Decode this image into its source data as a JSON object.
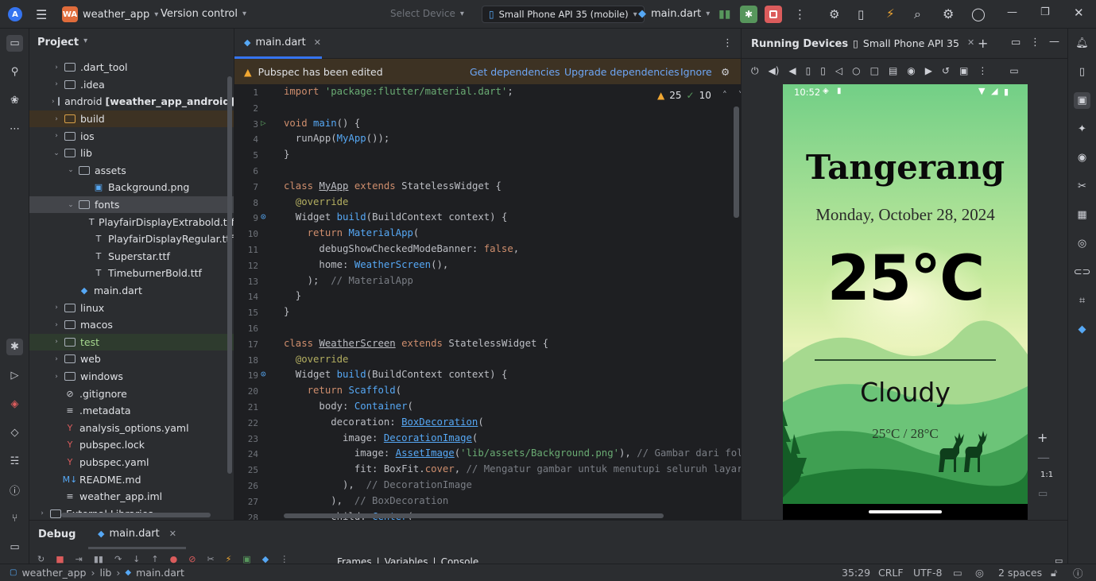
{
  "titlebar": {
    "project_badge": "WA",
    "project_name": "weather_app",
    "version_control": "Version control",
    "select_device": "Select Device",
    "device": "Small Phone API 35 (mobile)",
    "run_config": "main.dart"
  },
  "project_panel": {
    "title": "Project",
    "items": [
      {
        "label": ".dart_tool",
        "type": "folder",
        "indent": 1,
        "expanded": false
      },
      {
        "label": ".idea",
        "type": "folder",
        "indent": 1,
        "expanded": false
      },
      {
        "label": "android",
        "suffix": "[weather_app_android]",
        "type": "folder",
        "indent": 1,
        "expanded": false
      },
      {
        "label": "build",
        "type": "folder",
        "indent": 1,
        "expanded": false,
        "highlight": true
      },
      {
        "label": "ios",
        "type": "folder",
        "indent": 1,
        "expanded": false
      },
      {
        "label": "lib",
        "type": "folder",
        "indent": 1,
        "expanded": true
      },
      {
        "label": "assets",
        "type": "folder",
        "indent": 2,
        "expanded": true
      },
      {
        "label": "Background.png",
        "type": "image",
        "indent": 3
      },
      {
        "label": "fonts",
        "type": "folder",
        "indent": 2,
        "expanded": true,
        "selected": true
      },
      {
        "label": "PlayfairDisplayExtrabold.ttf",
        "type": "font",
        "indent": 3
      },
      {
        "label": "PlayfairDisplayRegular.ttf",
        "type": "font",
        "indent": 3
      },
      {
        "label": "Superstar.ttf",
        "type": "font",
        "indent": 3
      },
      {
        "label": "TimeburnerBold.ttf",
        "type": "font",
        "indent": 3
      },
      {
        "label": "main.dart",
        "type": "dart",
        "indent": 2
      },
      {
        "label": "linux",
        "type": "folder",
        "indent": 1,
        "expanded": false
      },
      {
        "label": "macos",
        "type": "folder",
        "indent": 1,
        "expanded": false
      },
      {
        "label": "test",
        "type": "folder",
        "indent": 1,
        "expanded": false,
        "green": true
      },
      {
        "label": "web",
        "type": "folder",
        "indent": 1,
        "expanded": false
      },
      {
        "label": "windows",
        "type": "folder",
        "indent": 1,
        "expanded": false
      },
      {
        "label": ".gitignore",
        "type": "ignore",
        "indent": 1
      },
      {
        "label": ".metadata",
        "type": "text",
        "indent": 1
      },
      {
        "label": "analysis_options.yaml",
        "type": "yaml",
        "indent": 1
      },
      {
        "label": "pubspec.lock",
        "type": "yaml",
        "indent": 1
      },
      {
        "label": "pubspec.yaml",
        "type": "yaml",
        "indent": 1
      },
      {
        "label": "README.md",
        "type": "md",
        "indent": 1
      },
      {
        "label": "weather_app.iml",
        "type": "text",
        "indent": 1
      },
      {
        "label": "External Libraries",
        "type": "lib",
        "indent": 0,
        "expanded": false
      }
    ]
  },
  "editor": {
    "tab": "main.dart",
    "banner_text": "Pubspec has been edited",
    "get_deps": "Get dependencies",
    "upgrade_deps": "Upgrade dependencies",
    "ignore": "Ignore",
    "warnings": "25",
    "checks": "10",
    "lines": [
      {
        "n": "1",
        "html": "<span class=\"kw\">import</span> <span class=\"st\">'package:flutter/material.dart'</span>;"
      },
      {
        "n": "2",
        "html": ""
      },
      {
        "n": "3",
        "html": "<span class=\"kw\">void</span> <span class=\"fn\">main</span>() {"
      },
      {
        "n": "4",
        "html": "  runApp(<span class=\"fn\">MyApp</span>());"
      },
      {
        "n": "5",
        "html": "}"
      },
      {
        "n": "6",
        "html": ""
      },
      {
        "n": "7",
        "html": "<span class=\"kw\">class</span> <u>MyApp</u> <span class=\"kw\">extends</span> StatelessWidget {"
      },
      {
        "n": "8",
        "html": "  <span class=\"an\">@override</span>"
      },
      {
        "n": "9",
        "html": "  Widget <span class=\"fn\">build</span>(BuildContext context) {"
      },
      {
        "n": "10",
        "html": "    <span class=\"kw\">return</span> <span class=\"fn\">MaterialApp</span>("
      },
      {
        "n": "11",
        "html": "      debugShowCheckedModeBanner: <span class=\"kw\">false</span>,"
      },
      {
        "n": "12",
        "html": "      home: <span class=\"fn\">WeatherScreen</span>(),"
      },
      {
        "n": "13",
        "html": "    );  <span class=\"cm\">// MaterialApp</span>"
      },
      {
        "n": "14",
        "html": "  }"
      },
      {
        "n": "15",
        "html": "}"
      },
      {
        "n": "16",
        "html": ""
      },
      {
        "n": "17",
        "html": "<span class=\"kw\">class</span> <u>WeatherScreen</u> <span class=\"kw\">extends</span> StatelessWidget {"
      },
      {
        "n": "18",
        "html": "  <span class=\"an\">@override</span>"
      },
      {
        "n": "19",
        "html": "  Widget <span class=\"fn\">build</span>(BuildContext context) {"
      },
      {
        "n": "20",
        "html": "    <span class=\"kw\">return</span> <span class=\"fn\">Scaffold</span>("
      },
      {
        "n": "21",
        "html": "      body: <span class=\"fn\">Container</span>("
      },
      {
        "n": "22",
        "html": "        decoration: <span class=\"cls\">BoxDecoration</span>("
      },
      {
        "n": "23",
        "html": "          image: <span class=\"cls\">DecorationImage</span>("
      },
      {
        "n": "24",
        "html": "            image: <span class=\"cls\">AssetImage</span>(<span class=\"st\">'lib/assets/Background.png'</span>), <span class=\"cm\">// Gambar dari folde</span>"
      },
      {
        "n": "25",
        "html": "            fit: BoxFit.<span class=\"kw\">cover</span>, <span class=\"cm\">// Mengatur gambar untuk menutupi seluruh layar</span>"
      },
      {
        "n": "26",
        "html": "          ),  <span class=\"cm\">// DecorationImage</span>"
      },
      {
        "n": "27",
        "html": "        ),  <span class=\"cm\">// BoxDecoration</span>"
      },
      {
        "n": "28",
        "html": "        child: <span class=\"fn\">Center</span>("
      }
    ]
  },
  "devices": {
    "title": "Running Devices",
    "tab": "Small Phone API 35",
    "phone": {
      "time": "10:52",
      "city": "Tangerang",
      "date": "Monday, October 28, 2024",
      "temp": "25°C",
      "condition": "Cloudy",
      "range": "25°C / 28°C"
    },
    "zoom_label": "1:1"
  },
  "debug": {
    "title": "Debug",
    "tab": "main.dart",
    "frames": "Frames",
    "variables": "Variables",
    "console": "Console"
  },
  "status": {
    "path": [
      "weather_app",
      "lib",
      "main.dart"
    ],
    "position": "35:29",
    "line_sep": "CRLF",
    "encoding": "UTF-8",
    "indent": "2 spaces"
  },
  "colors": {
    "accent": "#3574f0",
    "warning_banner": "#3d3223",
    "phone_green": "#6cc478"
  }
}
